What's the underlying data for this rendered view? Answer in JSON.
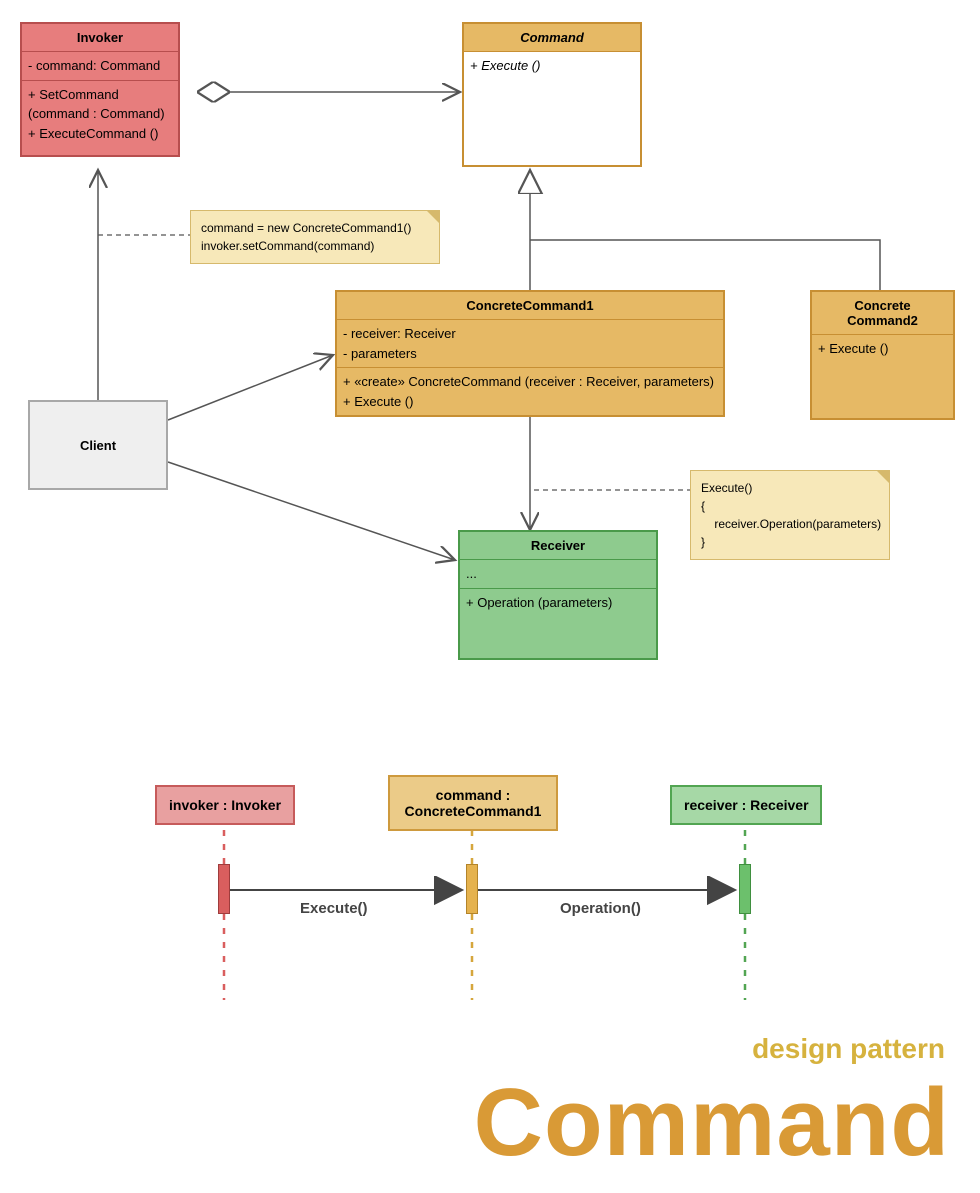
{
  "classes": {
    "invoker": {
      "title": "Invoker",
      "attrs": "- command: Command",
      "ops": "+ SetCommand\n(command : Command)\n+ ExecuteCommand ()"
    },
    "command": {
      "title": "Command",
      "ops": "+ Execute ()"
    },
    "concrete1": {
      "title": "ConcreteCommand1",
      "attrs": "- receiver: Receiver\n- parameters",
      "ops": "+ «create» ConcreteCommand (receiver : Receiver, parameters)\n+ Execute ()"
    },
    "concrete2": {
      "title": "Concrete\nCommand2",
      "ops": "+ Execute ()"
    },
    "client": {
      "title": "Client"
    },
    "receiver": {
      "title": "Receiver",
      "attrs": "...",
      "ops": "+ Operation (parameters)"
    }
  },
  "notes": {
    "note1": "command = new ConcreteCommand1()\ninvoker.setCommand(command)",
    "note2": "Execute()\n{\n    receiver.Operation(parameters)\n}"
  },
  "sequence": {
    "invoker": "invoker : Invoker",
    "command": "command :\nConcreteCommand1",
    "receiver": "receiver : Receiver",
    "msg1": "Execute()",
    "msg2": "Operation()"
  },
  "title": {
    "sub": "design pattern",
    "main": "Command"
  },
  "colors": {
    "red": "#E77D7D",
    "orange": "#E6B965",
    "green": "#8ECB8E",
    "gray": "#EFEFEF",
    "note": "#F7E8B9"
  }
}
